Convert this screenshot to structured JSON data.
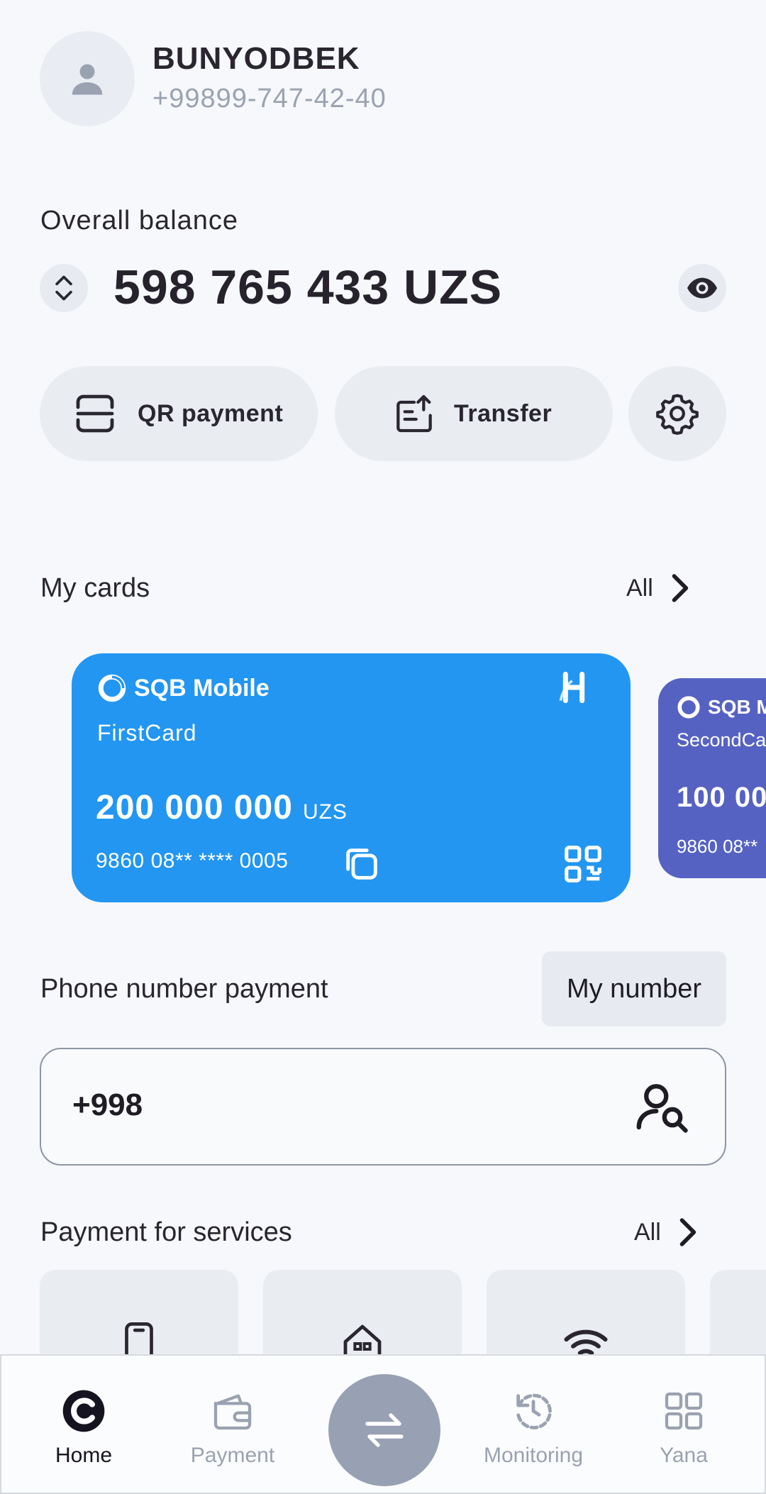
{
  "profile": {
    "name": "BUNYODBEK",
    "phone": "+99899-747-42-40"
  },
  "balance": {
    "label": "Overall balance",
    "amount": "598 765 433 UZS"
  },
  "actions": {
    "qr_label": "QR payment",
    "transfer_label": "Transfer"
  },
  "cards_section": {
    "title": "My cards",
    "all_label": "All",
    "cards": [
      {
        "brand": "SQB Mobile",
        "name": "FirstCard",
        "amount": "200 000 000",
        "currency": "UZS",
        "number": "9860 08** **** 0005",
        "color": "#2396f1"
      },
      {
        "brand": "SQB M",
        "name": "SecondCa",
        "amount": "100 00",
        "number": "9860 08**",
        "color": "#5662c2"
      }
    ]
  },
  "phone_payment": {
    "title": "Phone number payment",
    "my_number_label": "My number",
    "input_value": "+998"
  },
  "services": {
    "title": "Payment for services",
    "all_label": "All"
  },
  "nav": {
    "items": [
      {
        "label": "Home",
        "active": true
      },
      {
        "label": "Payment"
      },
      {
        "label": "Monitoring"
      },
      {
        "label": "Yana"
      }
    ]
  },
  "colors": {
    "accent": "#2396f1",
    "card2": "#5662c2",
    "fab": "#98a0b3"
  }
}
